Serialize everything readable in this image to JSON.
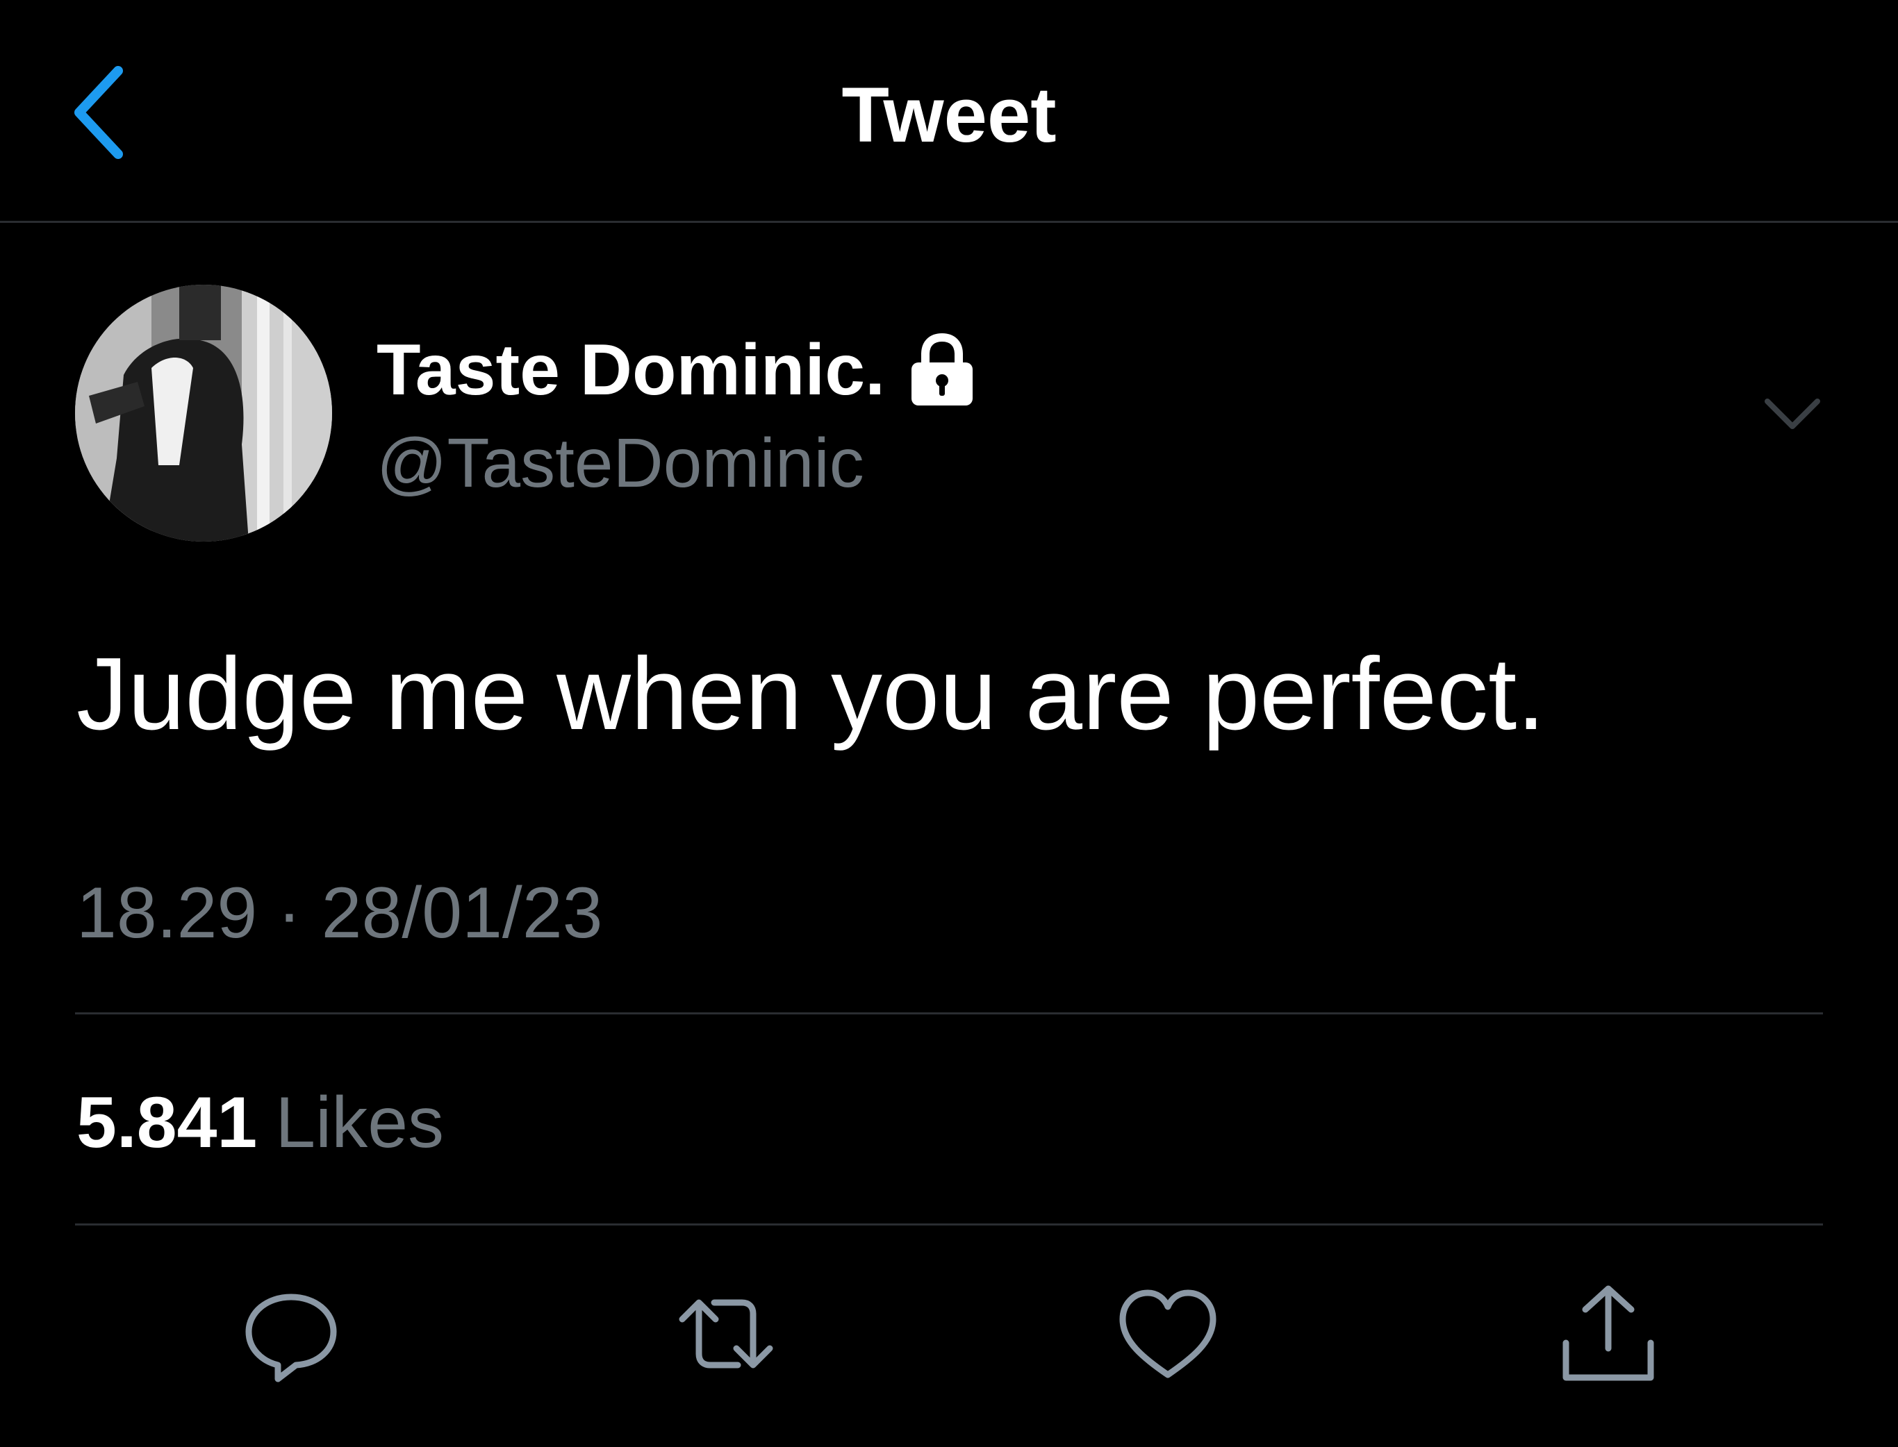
{
  "header": {
    "title": "Tweet",
    "back_icon": "chevron-left-icon"
  },
  "tweet": {
    "author": {
      "display_name": "Taste Dominic.",
      "handle": "@TasteDominic",
      "protected_icon": "lock-icon"
    },
    "text": "Judge me when you are perfect.",
    "timestamp": "18.29 · 28/01/23",
    "likes": {
      "count": "5.841",
      "label": "Likes"
    }
  },
  "actions": [
    {
      "name": "reply",
      "icon": "reply-icon"
    },
    {
      "name": "retweet",
      "icon": "retweet-icon"
    },
    {
      "name": "like",
      "icon": "heart-icon"
    },
    {
      "name": "share",
      "icon": "share-icon"
    }
  ],
  "colors": {
    "background": "#000000",
    "accent": "#1d9bf0",
    "secondary_text": "#6e767d",
    "divider": "#2a2d31",
    "icon_gray": "#8b98a5"
  }
}
